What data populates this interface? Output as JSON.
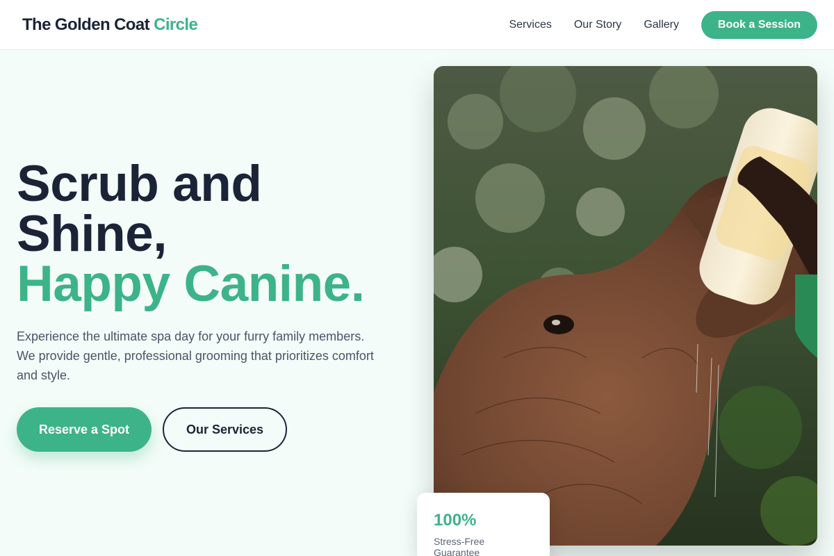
{
  "header": {
    "brand_main": "The Golden Coat",
    "brand_accent": "Circle",
    "nav": {
      "services": "Services",
      "story": "Our Story",
      "gallery": "Gallery"
    },
    "cta": "Book a Session"
  },
  "hero": {
    "title_line1": "Scrub and",
    "title_line2": "Shine,",
    "title_accent": "Happy Canine.",
    "description": "Experience the ultimate spa day for your furry family members. We provide gentle, professional grooming that prioritizes comfort and style.",
    "primary_button": "Reserve a Spot",
    "secondary_button": "Our Services"
  },
  "badge": {
    "value": "100%",
    "label": "Stress-Free Guarantee"
  },
  "colors": {
    "accent": "#3db38a",
    "dark": "#1b2437",
    "background": "#f3fcf8"
  }
}
